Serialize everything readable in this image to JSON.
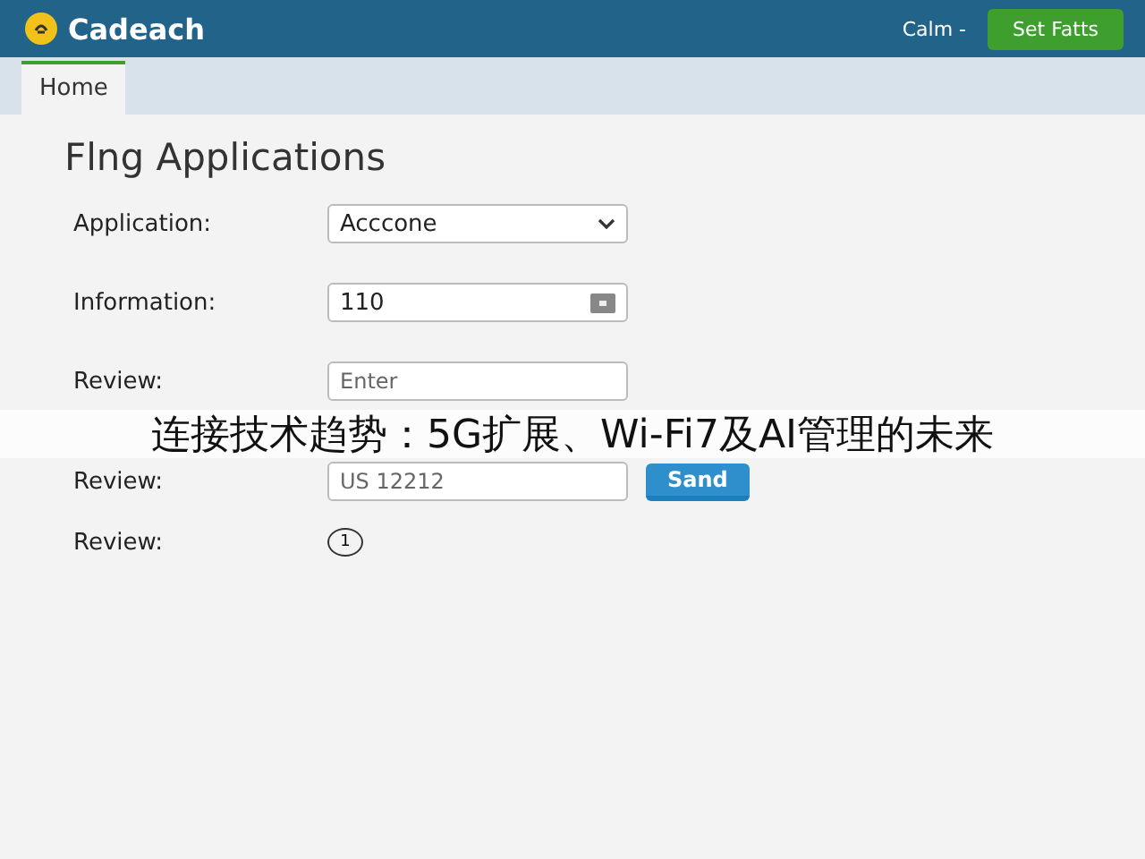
{
  "header": {
    "logo": "Cadeach",
    "user_menu": "Calm -",
    "action_button": "Set Fatts"
  },
  "tabs": [
    {
      "label": "Home",
      "selected": true
    }
  ],
  "form": {
    "title": "Flng Applications",
    "rows": [
      {
        "kind": "select",
        "label": "Application:",
        "value": "Acccone"
      },
      {
        "kind": "input_icon",
        "label": "Information:",
        "value": "110"
      },
      {
        "kind": "input",
        "label": "Review:",
        "placeholder": "Enter"
      },
      {
        "kind": "input_button",
        "label": "Review:",
        "placeholder": "US 12212",
        "button": "Sand"
      },
      {
        "kind": "badge",
        "label": "Review:",
        "value": "1"
      }
    ]
  },
  "caption": "连接技术趋势：5G扩展、Wi-Fi7及AI管理的未来"
}
